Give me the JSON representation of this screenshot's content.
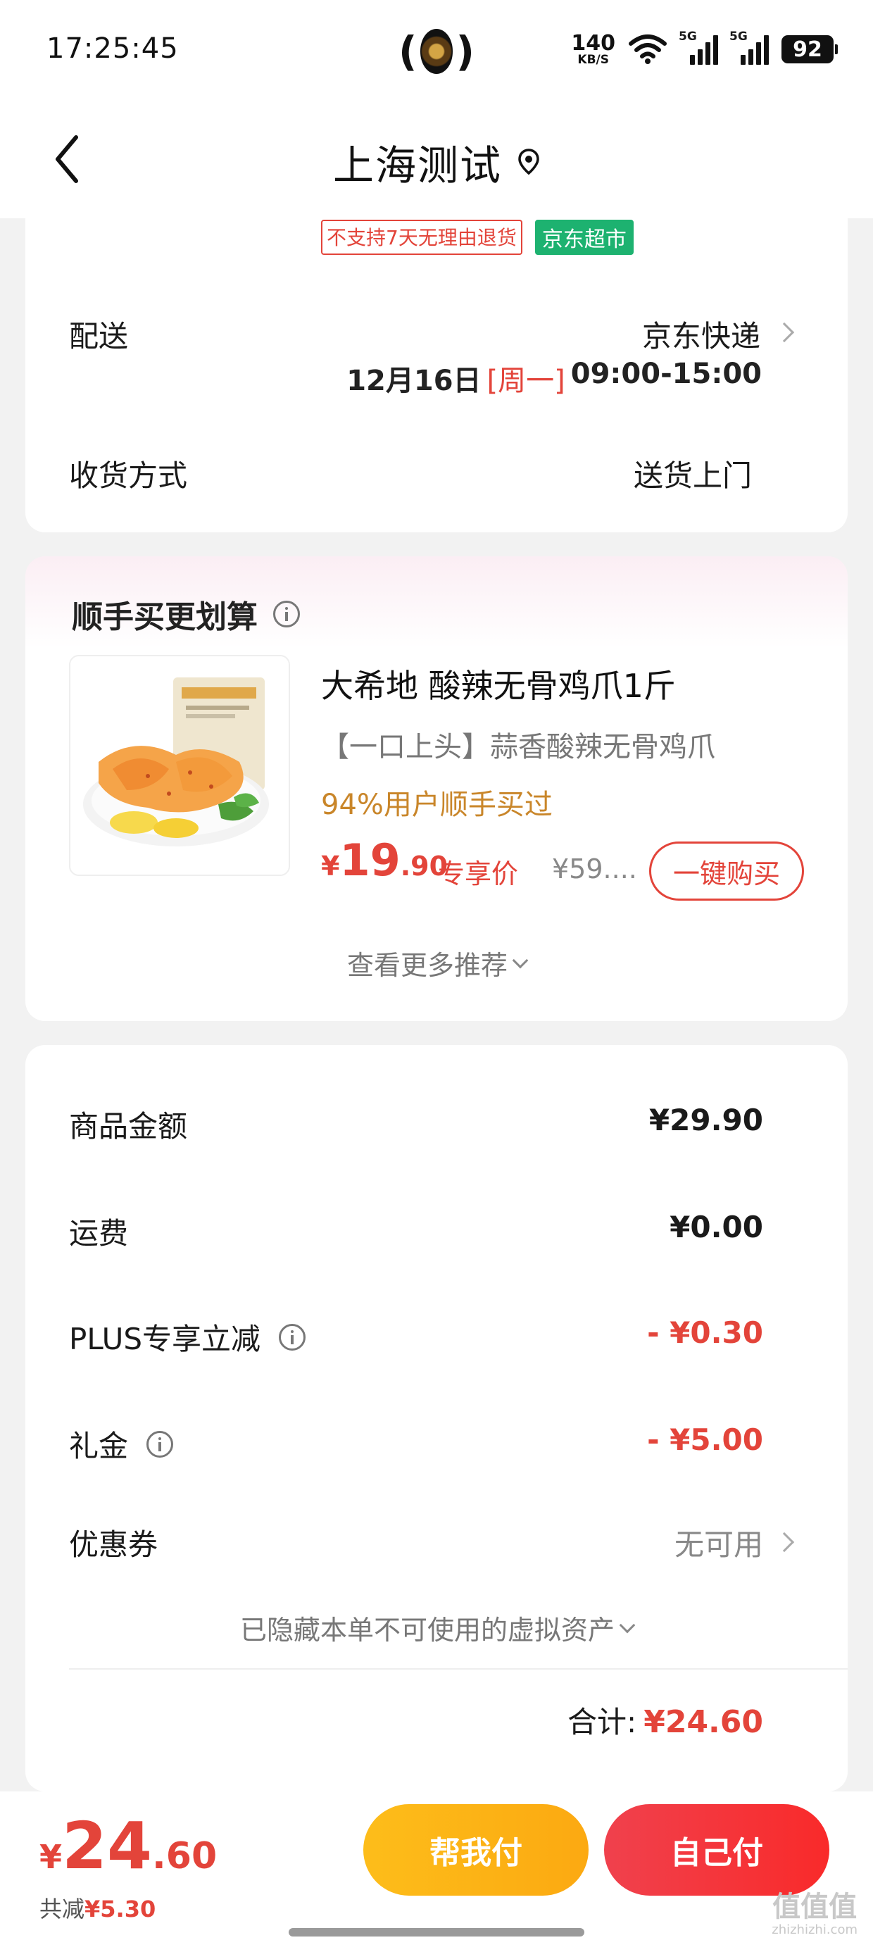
{
  "status_bar": {
    "time": "17:25:45",
    "net_speed": "140",
    "net_unit": "KB/S",
    "sig1_label": "5G",
    "sig2_label": "5G",
    "battery": "92"
  },
  "header": {
    "title": "上海测试"
  },
  "delivery": {
    "tag_no_return": "不支持7天无理由退货",
    "tag_store": "京东超市",
    "delivery_label": "配送",
    "delivery_value": "京东快递",
    "delivery_date": "12月16日",
    "delivery_weekday": "[周一]",
    "delivery_window": "09:00-15:00",
    "receive_label": "收货方式",
    "receive_value": "送货上门"
  },
  "recommend": {
    "title": "顺手买更划算",
    "product_name": "大希地 酸辣无骨鸡爪1斤",
    "product_sub": "【一口上头】蒜香酸辣无骨鸡爪",
    "product_stat": "94%用户顺手买过",
    "price_symbol": "¥",
    "price_int": "19",
    "price_dec": ".90",
    "price_tag": "专享价",
    "orig_price": "¥59....",
    "buy_label": "一键购买",
    "more_label": "查看更多推荐"
  },
  "price": {
    "rows": [
      {
        "label": "商品金额",
        "value": "¥29.90"
      },
      {
        "label": "运费",
        "value": "¥0.00"
      },
      {
        "label": "PLUS专享立减",
        "value": "- ¥0.30"
      },
      {
        "label": "礼金",
        "value": "- ¥5.00"
      },
      {
        "label": "优惠券",
        "value": "无可用"
      }
    ],
    "hidden_assets": "已隐藏本单不可使用的虚拟资产",
    "total_label": "合计:",
    "total_value": "¥24.60"
  },
  "bottom": {
    "pay_symbol": "¥",
    "pay_int": "24",
    "pay_dec": ".60",
    "saved_label": "共减",
    "saved_value": "¥5.30",
    "help_pay": "帮我付",
    "self_pay": "自己付"
  },
  "watermark": {
    "main": "值值值",
    "sub": "zhizhizhi.com"
  },
  "colors": {
    "accent_red": "#e3443a",
    "store_green": "#1db270",
    "help_pay_yellow": "#fdbd1a",
    "stat_orange": "#c9862a"
  }
}
